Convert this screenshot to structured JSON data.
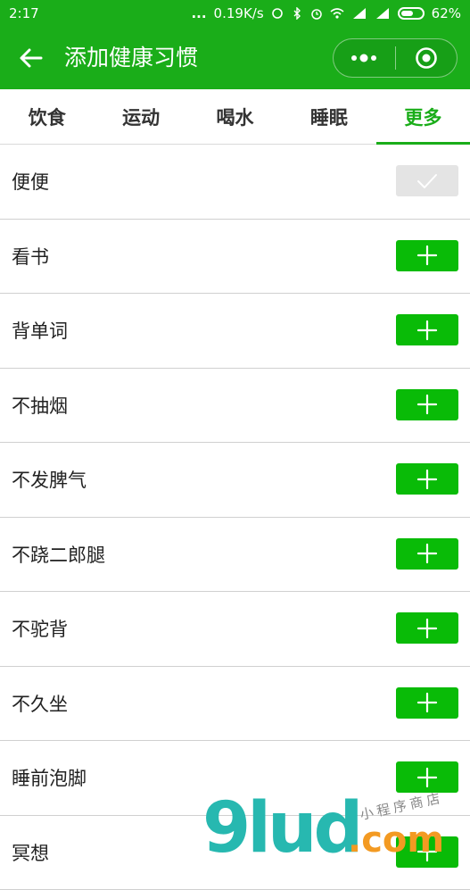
{
  "status_bar": {
    "time": "2:17",
    "dots": "...",
    "speed": "0.19K/s",
    "battery": "62%",
    "battery_level": 0.62
  },
  "navbar": {
    "title": "添加健康习惯",
    "icons": [
      "back-arrow-icon",
      "more-dots-icon",
      "close-target-icon"
    ]
  },
  "tabs": [
    {
      "label": "饮食",
      "active": false
    },
    {
      "label": "运动",
      "active": false
    },
    {
      "label": "喝水",
      "active": false
    },
    {
      "label": "睡眠",
      "active": false
    },
    {
      "label": "更多",
      "active": true
    }
  ],
  "habits": [
    {
      "label": "便便",
      "added": true
    },
    {
      "label": "看书",
      "added": false
    },
    {
      "label": "背单词",
      "added": false
    },
    {
      "label": "不抽烟",
      "added": false
    },
    {
      "label": "不发脾气",
      "added": false
    },
    {
      "label": "不跷二郎腿",
      "added": false
    },
    {
      "label": "不驼背",
      "added": false
    },
    {
      "label": "不久坐",
      "added": false
    },
    {
      "label": "睡前泡脚",
      "added": false
    },
    {
      "label": "冥想",
      "added": false
    }
  ],
  "watermark": {
    "brand": "9lud",
    "suffix": ".com",
    "tagline": "小程序商店"
  },
  "colors": {
    "primary": "#1aad19",
    "button": "#09bb07",
    "button_done": "#e4e4e4",
    "watermark_teal": "#27b8b0",
    "watermark_orange": "#f39a22"
  }
}
